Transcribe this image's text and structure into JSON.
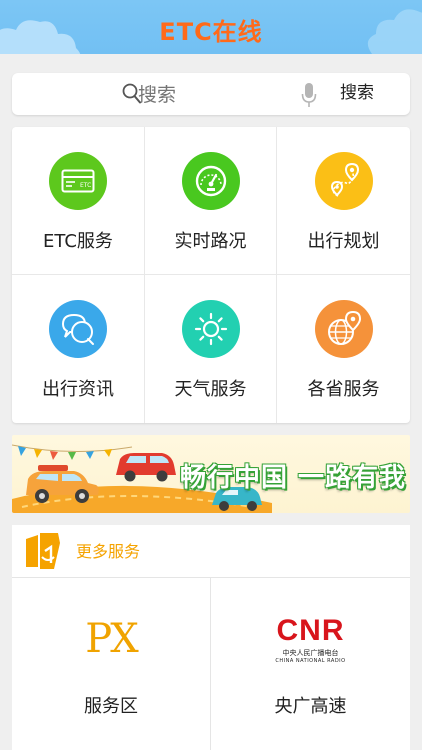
{
  "header": {
    "title": "ETC在线"
  },
  "search": {
    "placeholder": "搜索",
    "button_label": "搜索"
  },
  "services": [
    {
      "label": "ETC服务",
      "icon": "card-icon",
      "color": "#5dc81d"
    },
    {
      "label": "实时路况",
      "icon": "speedometer-icon",
      "color": "#49c81f"
    },
    {
      "label": "出行规划",
      "icon": "route-pin-icon",
      "color": "#fbbf16"
    },
    {
      "label": "出行资讯",
      "icon": "chat-bubbles-icon",
      "color": "#3aa8ea"
    },
    {
      "label": "天气服务",
      "icon": "sun-icon",
      "color": "#22d0b1"
    },
    {
      "label": "各省服务",
      "icon": "globe-pin-icon",
      "color": "#f5923a"
    }
  ],
  "banner": {
    "slogan": "畅行中国 一路有我"
  },
  "more_services": {
    "title": "更多服务",
    "items": [
      {
        "label": "服务区",
        "logo_text": "PX"
      },
      {
        "label": "央广高速",
        "logo_text": "CNR",
        "logo_cn": "中央人民广播电台",
        "logo_en": "CHINA NATIONAL RADIO"
      }
    ]
  },
  "colors": {
    "title": "#ff6a1a",
    "header_bg": "#7cc6f5",
    "accent": "#f5a300",
    "cnr_red": "#d8151c"
  }
}
